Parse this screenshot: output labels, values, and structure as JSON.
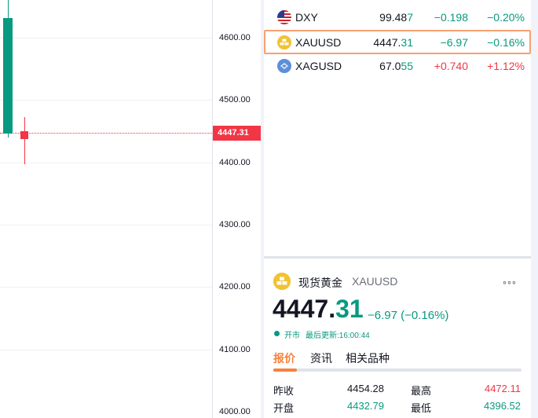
{
  "price_scale": {
    "ticks": [
      "4600.00",
      "4500.00",
      "4400.00",
      "4300.00",
      "4200.00",
      "4100.00",
      "4000.00"
    ],
    "last_price": "4447.31"
  },
  "candles": [
    {
      "open": 4446,
      "close": 4631,
      "high": 4660,
      "low": 4440,
      "color": "#089981"
    },
    {
      "open": 4450,
      "close": 4437,
      "high": 4473,
      "low": 4397,
      "color": "#f23645"
    }
  ],
  "watchlist": [
    {
      "symbol": "DXY",
      "last_main": "99.48",
      "last_tail": "7",
      "change": "−0.198",
      "change_pct": "−0.20%",
      "dir": "down",
      "flag": "us-flag-icon"
    },
    {
      "symbol": "XAUUSD",
      "last_main": "4447.",
      "last_tail": "31",
      "change": "−6.97",
      "change_pct": "−0.16%",
      "dir": "down",
      "flag": "gold-icon"
    },
    {
      "symbol": "XAGUSD",
      "last_main": "67.0",
      "last_tail": "55",
      "change": "+0.740",
      "change_pct": "+1.12%",
      "dir": "up",
      "flag": "silver-icon"
    }
  ],
  "detail": {
    "name": "现货黄金",
    "symbol": "XAUUSD",
    "more": "◦◦◦",
    "price_main": "4447.",
    "price_dec": "31",
    "change": "−6.97 (−0.16%)",
    "status": "开市",
    "updated": "最后更新:16:00:44",
    "tabs": [
      "报价",
      "资讯",
      "相关品种"
    ],
    "stats": {
      "prev_close_label": "昨收",
      "prev_close": "4454.28",
      "high_label": "最高",
      "high": "4472.11",
      "open_label": "开盘",
      "open": "4432.79",
      "low_label": "最低",
      "low": "4396.52"
    }
  },
  "colors": {
    "up": "#089981",
    "down": "#f23645",
    "accent": "#f7813a"
  }
}
